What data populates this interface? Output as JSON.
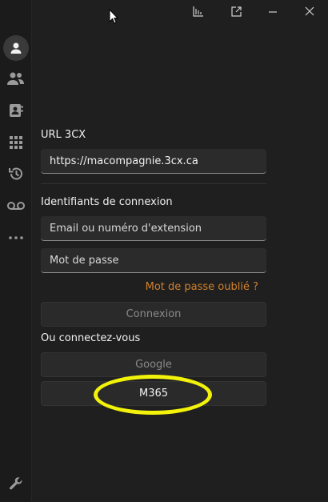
{
  "titlebar": {
    "icons": [
      "chart-icon",
      "popout-icon",
      "minimize-icon",
      "close-icon"
    ]
  },
  "sidebar": {
    "items": [
      {
        "icon": "avatar-icon"
      },
      {
        "icon": "people-icon"
      },
      {
        "icon": "contacts-icon"
      },
      {
        "icon": "dialpad-icon"
      },
      {
        "icon": "history-icon"
      },
      {
        "icon": "voicemail-icon"
      },
      {
        "icon": "more-icon"
      },
      {
        "icon": "wrench-icon"
      }
    ]
  },
  "login": {
    "url_label": "URL 3CX",
    "url_value": "https://macompagnie.3cx.ca",
    "credentials_label": "Identifiants de connexion",
    "email_placeholder": "Email ou numéro d'extension",
    "password_placeholder": "Mot de passe",
    "forgot_password": "Mot de passe oublié ?",
    "connect_button": "Connexion",
    "or_connect_label": "Ou connectez-vous",
    "google_button": "Google",
    "m365_button": "M365"
  },
  "colors": {
    "background": "#1f1f1f",
    "link": "#d0812c",
    "highlight": "#f2f20a"
  }
}
